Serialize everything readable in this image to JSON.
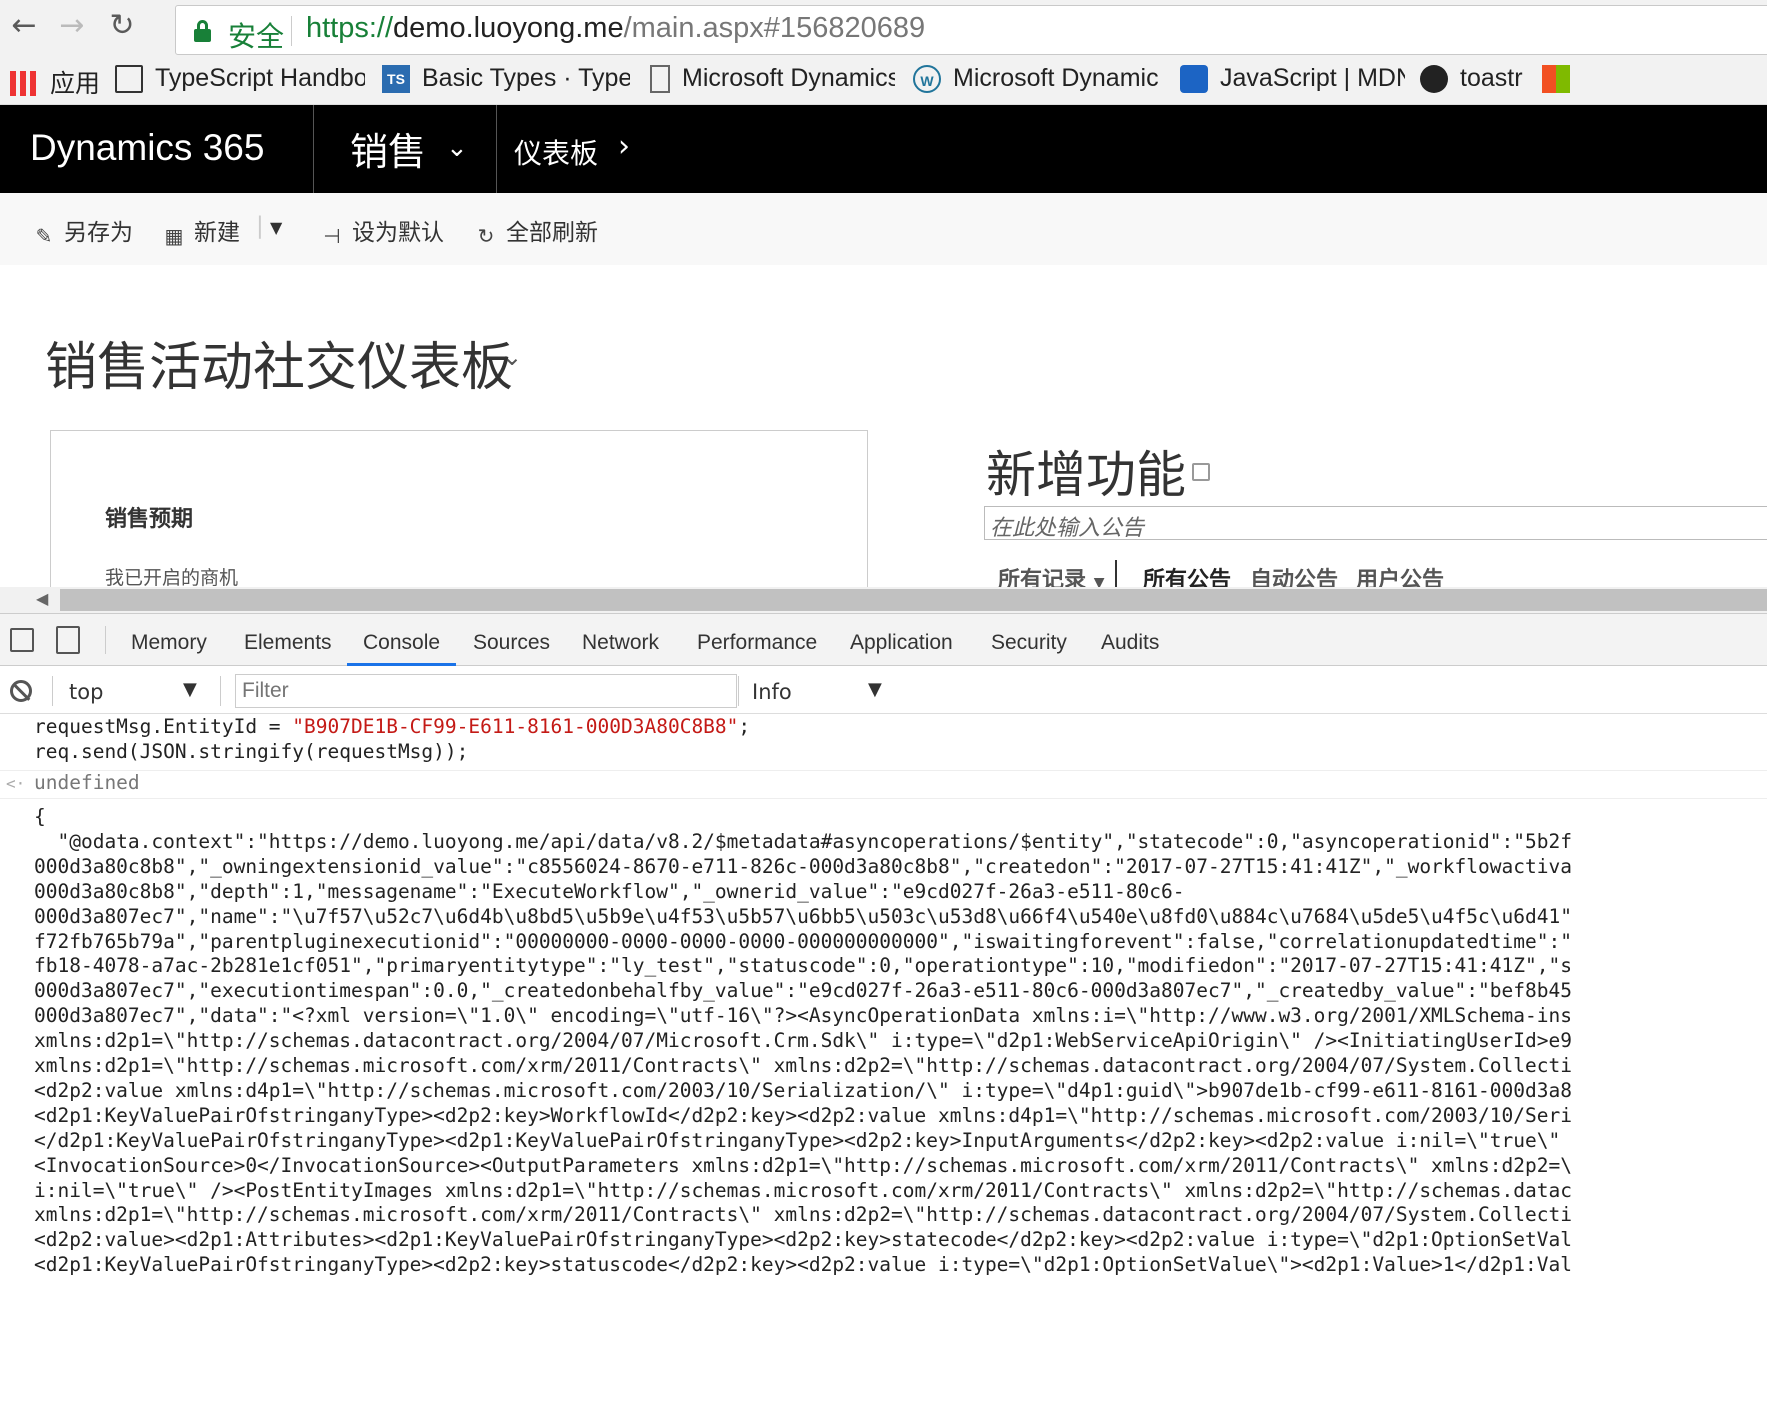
{
  "browser": {
    "back_icon": "arrow-left-icon",
    "forward_icon": "arrow-right-icon",
    "reload_icon": "reload-icon",
    "security_label": "安全",
    "url_protocol": "https://",
    "url_domain": "demo.luoyong.me",
    "url_rest": "/main.aspx#156820689"
  },
  "bookmarks": [
    {
      "label": "应用",
      "icon": "apps-grid-icon"
    },
    {
      "label": "TypeScript Handbo",
      "icon": "book-icon"
    },
    {
      "label": "Basic Types · TypeS",
      "icon": "ts-icon"
    },
    {
      "label": "Microsoft Dynamics",
      "icon": "page-icon"
    },
    {
      "label": "Microsoft Dynamic",
      "icon": "wordpress-icon"
    },
    {
      "label": "JavaScript | MDN",
      "icon": "mdn-icon"
    },
    {
      "label": "toastr",
      "icon": "github-icon"
    }
  ],
  "crm": {
    "brand": "Dynamics 365",
    "app": "销售",
    "area": "仪表板",
    "commands": [
      "另存为",
      "新建",
      "设为默认",
      "全部刷新"
    ],
    "page_title": "销售活动社交仪表板",
    "panel": {
      "title": "销售预期",
      "subtitle": "我已开启的商机"
    },
    "news": {
      "title": "新增功能",
      "placeholder": "在此处输入公告",
      "filter_label": "所有记录",
      "tabs": [
        "所有公告",
        "自动公告",
        "用户公告"
      ]
    }
  },
  "devtools": {
    "tabs": [
      "Memory",
      "Elements",
      "Console",
      "Sources",
      "Network",
      "Performance",
      "Application",
      "Security",
      "Audits"
    ],
    "active_tab": "Console",
    "context": "top",
    "filter_placeholder": "Filter",
    "level": "Info",
    "console": {
      "input_line1_pre": "requestMsg.EntityId = ",
      "input_line1_str": "\"B907DE1B-CF99-E611-8161-000D3A80C8B8\"",
      "input_line1_post": ";",
      "input_line2": "req.send(JSON.stringify(requestMsg));",
      "result": "undefined",
      "output_lines": [
        "{",
        "  \"@odata.context\":\"https://demo.luoyong.me/api/data/v8.2/$metadata#asyncoperations/$entity\",\"statecode\":0,\"asyncoperationid\":\"5b2f",
        "000d3a80c8b8\",\"_owningextensionid_value\":\"c8556024-8670-e711-826c-000d3a80c8b8\",\"createdon\":\"2017-07-27T15:41:41Z\",\"_workflowactiva",
        "000d3a80c8b8\",\"depth\":1,\"messagename\":\"ExecuteWorkflow\",\"_ownerid_value\":\"e9cd027f-26a3-e511-80c6-",
        "000d3a807ec7\",\"name\":\"\\u7f57\\u52c7\\u6d4b\\u8bd5\\u5b9e\\u4f53\\u5b57\\u6bb5\\u503c\\u53d8\\u66f4\\u540e\\u8fd0\\u884c\\u7684\\u5de5\\u4f5c\\u6d41\"",
        "f72fb765b79a\",\"parentpluginexecutionid\":\"00000000-0000-0000-0000-000000000000\",\"iswaitingforevent\":false,\"correlationupdatedtime\":\"",
        "fb18-4078-a7ac-2b281e1cf051\",\"primaryentitytype\":\"ly_test\",\"statuscode\":0,\"operationtype\":10,\"modifiedon\":\"2017-07-27T15:41:41Z\",\"s",
        "000d3a807ec7\",\"executiontimespan\":0.0,\"_createdonbehalfby_value\":\"e9cd027f-26a3-e511-80c6-000d3a807ec7\",\"_createdby_value\":\"bef8b45",
        "000d3a807ec7\",\"data\":\"<?xml version=\\\"1.0\\\" encoding=\\\"utf-16\\\"?><AsyncOperationData xmlns:i=\\\"http://www.w3.org/2001/XMLSchema-ins",
        "xmlns:d2p1=\\\"http://schemas.datacontract.org/2004/07/Microsoft.Crm.Sdk\\\" i:type=\\\"d2p1:WebServiceApiOrigin\\\" /><InitiatingUserId>e9",
        "xmlns:d2p1=\\\"http://schemas.microsoft.com/xrm/2011/Contracts\\\" xmlns:d2p2=\\\"http://schemas.datacontract.org/2004/07/System.Collecti",
        "<d2p2:value xmlns:d4p1=\\\"http://schemas.microsoft.com/2003/10/Serialization/\\\" i:type=\\\"d4p1:guid\\\">b907de1b-cf99-e611-8161-000d3a8",
        "<d2p1:KeyValuePairOfstringanyType><d2p2:key>WorkflowId</d2p2:key><d2p2:value xmlns:d4p1=\\\"http://schemas.microsoft.com/2003/10/Seri",
        "</d2p1:KeyValuePairOfstringanyType><d2p1:KeyValuePairOfstringanyType><d2p2:key>InputArguments</d2p2:key><d2p2:value i:nil=\\\"true\\\"",
        "<InvocationSource>0</InvocationSource><OutputParameters xmlns:d2p1=\\\"http://schemas.microsoft.com/xrm/2011/Contracts\\\" xmlns:d2p2=\\",
        "i:nil=\\\"true\\\" /><PostEntityImages xmlns:d2p1=\\\"http://schemas.microsoft.com/xrm/2011/Contracts\\\" xmlns:d2p2=\\\"http://schemas.datac",
        "xmlns:d2p1=\\\"http://schemas.microsoft.com/xrm/2011/Contracts\\\" xmlns:d2p2=\\\"http://schemas.datacontract.org/2004/07/System.Collecti",
        "<d2p2:value><d2p1:Attributes><d2p1:KeyValuePairOfstringanyType><d2p2:key>statecode</d2p2:key><d2p2:value i:type=\\\"d2p1:OptionSetVal",
        "<d2p1:KeyValuePairOfstringanyType><d2p2:key>statuscode</d2p2:key><d2p2:value i:type=\\\"d2p1:OptionSetValue\\\"><d2p1:Value>1</d2p1:Val"
      ]
    }
  }
}
